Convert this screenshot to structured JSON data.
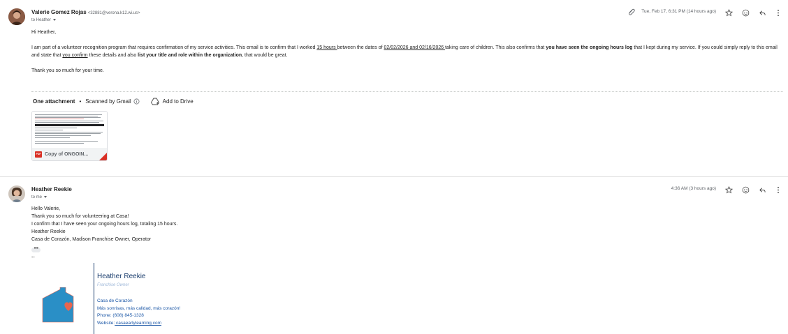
{
  "message1": {
    "sender_name": "Valerie Gomez Rojas",
    "sender_email": "<32881@verona.k12.wi.us>",
    "to_label": "to Heather",
    "timestamp": "Tue, Feb 17, 6:31 PM (14 hours ago)",
    "greeting": "Hi Heather,",
    "body_p1_a": "I am part of a volunteer recognition program that requires confirmation of my service activities. This email is to confirm that I worked ",
    "body_p1_hours": "15 hours ",
    "body_p1_b": "between the dates of ",
    "body_p1_dates": "02/02/2026 and 02/16/2026 ",
    "body_p1_c": " taking care of children. This also confirms that ",
    "body_p1_bold1": "you have seen the ongoing hours log",
    "body_p1_d": " that I kept during my service. If you could simply reply to this email and state that ",
    "body_p1_confirm": "you confirm",
    "body_p1_e": " these details and also ",
    "body_p1_bold2": "list your title and role within the organization",
    "body_p1_f": ", that would be great.",
    "thanks": "Thank you so much for your time.",
    "attachment_header": "One attachment",
    "scanned_label": "Scanned by Gmail",
    "add_to_drive": "Add to Drive",
    "attachment_name": "Copy of ONGOIN..."
  },
  "message2": {
    "sender_name": "Heather Reekie",
    "to_label": "to me",
    "timestamp": "4:36 AM (3 hours ago)",
    "lines": [
      "Hello Valerie,",
      "Thank you so much for volunteering at Casa!",
      "I confirm that I have seen your ongoing hours log, totaling 15 hours.",
      "Heather Reekie",
      "Casa de Corazón, Madison Franchise Owner, Operator"
    ],
    "ellipsis": "•••",
    "dashes": "--",
    "signature": {
      "name": "Heather Reekie",
      "role": "Franchise Owner",
      "org": "Casa de Corazón",
      "tagline": "Más sonrisas, más calidad, más corazón!",
      "phone": "Phone: (608) 845-1328",
      "website_label": "Website:",
      "website": " casaearlylearning.com"
    }
  },
  "colors": {
    "logo_house": "#2a8fc6",
    "logo_heart": "#e8654f",
    "signature_text": "#1a3d6d",
    "link": "#1a56a6"
  }
}
